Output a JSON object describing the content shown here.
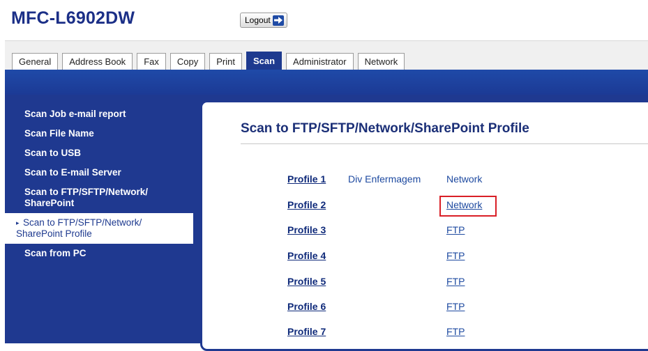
{
  "header": {
    "model": "MFC-L6902DW",
    "logout_label": "Logout"
  },
  "tabs": [
    {
      "label": "General",
      "active": false
    },
    {
      "label": "Address Book",
      "active": false
    },
    {
      "label": "Fax",
      "active": false
    },
    {
      "label": "Copy",
      "active": false
    },
    {
      "label": "Print",
      "active": false
    },
    {
      "label": "Scan",
      "active": true
    },
    {
      "label": "Administrator",
      "active": false
    },
    {
      "label": "Network",
      "active": false
    }
  ],
  "sidebar": {
    "items": [
      {
        "label": "Scan Job e-mail report"
      },
      {
        "label": "Scan File Name"
      },
      {
        "label": "Scan to USB"
      },
      {
        "label": "Scan to E-mail Server"
      },
      {
        "label": "Scan to FTP/SFTP/Network/ SharePoint"
      },
      {
        "label": "Scan to FTP/SFTP/Network/ SharePoint Profile",
        "active": true
      },
      {
        "label": "Scan from PC"
      }
    ]
  },
  "main": {
    "title": "Scan to FTP/SFTP/Network/SharePoint Profile",
    "profiles": [
      {
        "label": "Profile 1",
        "name": "Div Enfermagem",
        "type": "Network"
      },
      {
        "label": "Profile 2",
        "name": "",
        "type": "Network"
      },
      {
        "label": "Profile 3",
        "name": "",
        "type": "FTP"
      },
      {
        "label": "Profile 4",
        "name": "",
        "type": "FTP"
      },
      {
        "label": "Profile 5",
        "name": "",
        "type": "FTP"
      },
      {
        "label": "Profile 6",
        "name": "",
        "type": "FTP"
      },
      {
        "label": "Profile 7",
        "name": "",
        "type": "FTP"
      }
    ]
  },
  "colors": {
    "brand_blue": "#1f3990",
    "highlight_red": "#d91f26"
  },
  "icons": {
    "logout": "arrow-right-icon",
    "active_marker": "triangle-right-icon"
  }
}
